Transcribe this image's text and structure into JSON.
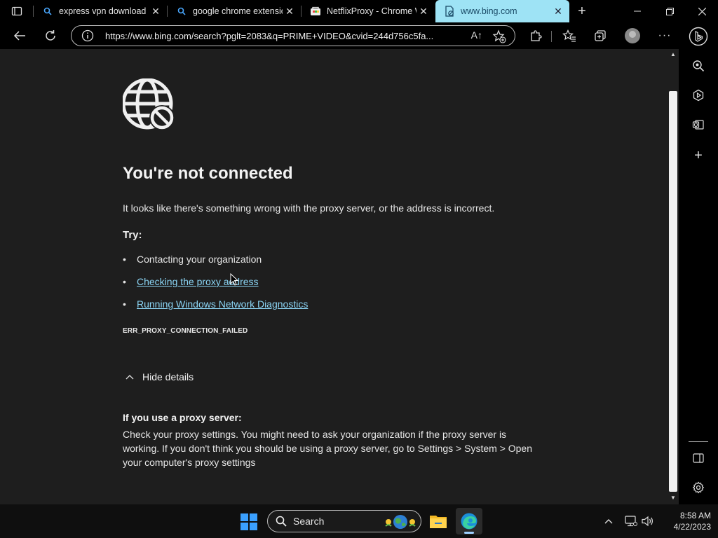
{
  "tabs": [
    {
      "title": "express vpn download - Search",
      "icon": "bing-search-icon",
      "active": false
    },
    {
      "title": "google chrome extension",
      "icon": "bing-search-icon",
      "active": false
    },
    {
      "title": "NetflixProxy - Chrome Web Store",
      "icon": "chrome-web-store-icon",
      "active": false
    },
    {
      "title": "www.bing.com",
      "icon": "broken-page-icon",
      "active": true
    }
  ],
  "address_bar": {
    "url": "https://www.bing.com/search?pglt=2083&q=PRIME+VIDEO&cvid=244d756c5fa...",
    "read_aloud": "A↑"
  },
  "error_page": {
    "headline": "You're not connected",
    "description": "It looks like there's something wrong with the proxy server, or the address is incorrect.",
    "try_label": "Try:",
    "suggestions": [
      {
        "text": "Contacting your organization",
        "link": false
      },
      {
        "text": "Checking the proxy address",
        "link": true
      },
      {
        "text": "Running Windows Network Diagnostics",
        "link": true
      }
    ],
    "error_code": "ERR_PROXY_CONNECTION_FAILED",
    "details_toggle": "Hide details",
    "details_heading": "If you use a proxy server:",
    "details_body": "Check your proxy settings. You might need to ask your organization if the proxy server is working. If you don't think you should be using a proxy server, go to Settings > System > Open your computer's proxy settings"
  },
  "taskbar": {
    "search_label": "Search",
    "time": "8:58 AM",
    "date": "4/22/2023"
  },
  "colors": {
    "active_tab": "#9ee3f5",
    "link": "#8bd5f5",
    "page_bg": "#1e1e1e"
  }
}
